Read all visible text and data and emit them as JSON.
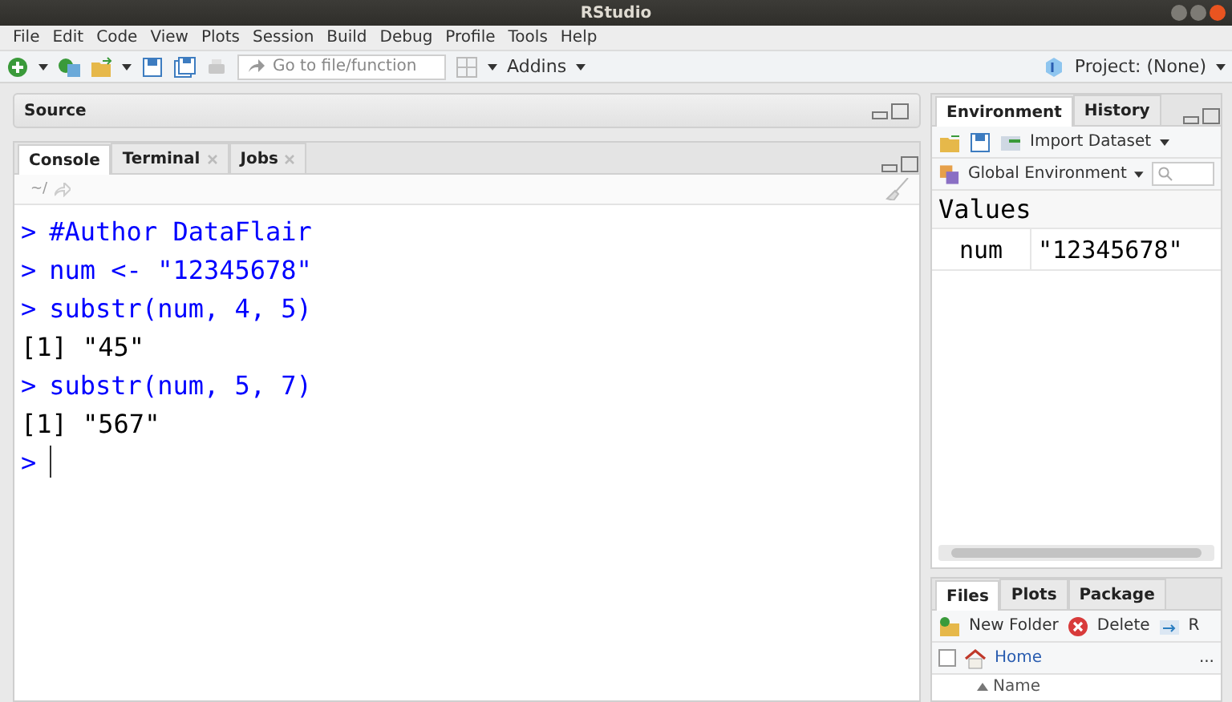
{
  "window": {
    "title": "RStudio"
  },
  "menu": [
    "File",
    "Edit",
    "Code",
    "View",
    "Plots",
    "Session",
    "Build",
    "Debug",
    "Profile",
    "Tools",
    "Help"
  ],
  "toolbar": {
    "goto_placeholder": "Go to file/function",
    "addins": "Addins",
    "project": "Project: (None)"
  },
  "source": {
    "title": "Source"
  },
  "console": {
    "tabs": [
      {
        "label": "Console",
        "selected": true,
        "closable": false
      },
      {
        "label": "Terminal",
        "selected": false,
        "closable": true
      },
      {
        "label": "Jobs",
        "selected": false,
        "closable": true
      }
    ],
    "path": "~/",
    "lines": [
      {
        "kind": "input",
        "prompt": ">",
        "text": "#Author DataFlair"
      },
      {
        "kind": "input",
        "prompt": ">",
        "text": "num <- \"12345678\""
      },
      {
        "kind": "input",
        "prompt": ">",
        "text": "substr(num, 4, 5)"
      },
      {
        "kind": "output",
        "text": "[1] \"45\""
      },
      {
        "kind": "input",
        "prompt": ">",
        "text": "substr(num, 5, 7)"
      },
      {
        "kind": "output",
        "text": "[1] \"567\""
      },
      {
        "kind": "cursor",
        "prompt": ">"
      }
    ]
  },
  "environment": {
    "tabs": [
      {
        "label": "Environment",
        "selected": true
      },
      {
        "label": "History",
        "selected": false
      }
    ],
    "import": "Import Dataset",
    "scope": "Global Environment",
    "section": "Values",
    "rows": [
      {
        "name": "num",
        "value": "\"12345678\""
      }
    ]
  },
  "files": {
    "tabs": [
      {
        "label": "Files",
        "selected": true
      },
      {
        "label": "Plots",
        "selected": false
      },
      {
        "label": "Package",
        "selected": false
      }
    ],
    "checked": false,
    "new_folder": "New Folder",
    "delete": "Delete",
    "rename": "R",
    "crumb": "Home",
    "more": "...",
    "column": "Name"
  }
}
